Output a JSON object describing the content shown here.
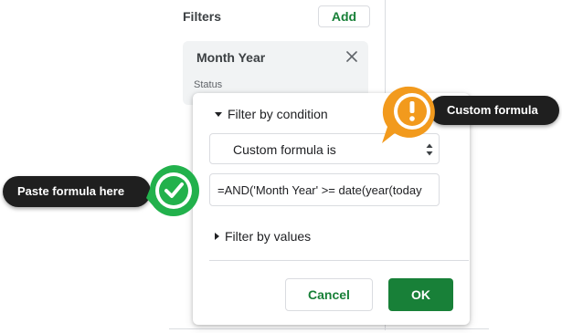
{
  "sidebar": {
    "filters_title": "Filters",
    "add_label": "Add",
    "filter_card": {
      "title": "Month Year",
      "status_label": "Status",
      "close_icon": "close-icon"
    }
  },
  "filter_popup": {
    "condition_section_label": "Filter by condition",
    "condition_select_value": "Custom formula is",
    "formula_value": "=AND('Month Year' >= date(year(today",
    "values_section_label": "Filter by values",
    "cancel_label": "Cancel",
    "ok_label": "OK"
  },
  "annotations": {
    "paste_formula_label": "Paste formula here",
    "custom_formula_label": "Custom formula",
    "check_marker_icon": "check-circle-icon",
    "warning_marker_icon": "exclamation-circle-icon"
  },
  "colors": {
    "accent_green": "#188038",
    "check_green": "#22b14c",
    "warning_orange": "#f29a1d",
    "callout_dark": "#1f1f1f",
    "border": "#dadce0"
  }
}
